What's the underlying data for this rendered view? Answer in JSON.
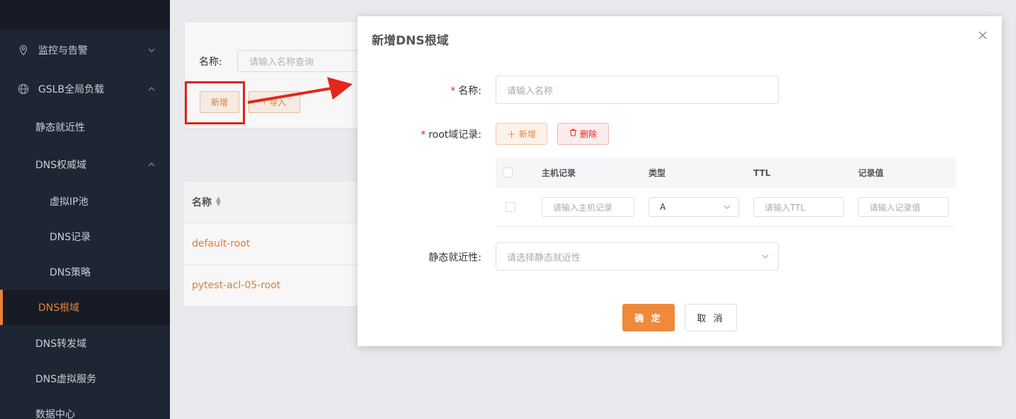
{
  "sidebar": {
    "items": [
      {
        "label": "监控与告警",
        "icon": "location-pin-icon"
      },
      {
        "label": "GSLB全局负载",
        "icon": "globe-icon"
      },
      {
        "label": "静态就近性"
      },
      {
        "label": "DNS权威域"
      },
      {
        "label": "虚拟IP池"
      },
      {
        "label": "DNS记录"
      },
      {
        "label": "DNS策略"
      },
      {
        "label": "DNS根域"
      },
      {
        "label": "DNS转发域"
      },
      {
        "label": "DNS虚拟服务"
      },
      {
        "label": "数据中心"
      }
    ],
    "active_color": "#e8823a"
  },
  "page": {
    "search_label": "名称:",
    "search_placeholder": "请输入名称查询",
    "add_button": "新增",
    "import_button": "导入",
    "table_header": "名称",
    "rows": [
      "default-root",
      "pytest-acl-05-root"
    ]
  },
  "dialog": {
    "title": "新增DNS根域",
    "name_label": "名称:",
    "name_placeholder": "请输入名称",
    "root_label": "root域记录:",
    "add_label": "新增",
    "delete_label": "删除",
    "columns": [
      "主机记录",
      "类型",
      "TTL",
      "记录值"
    ],
    "row": {
      "host_placeholder": "请输入主机记录",
      "type_value": "A",
      "ttl_placeholder": "请输入TTL",
      "value_placeholder": "请输入记录值"
    },
    "static_label": "静态就近性:",
    "static_placeholder": "请选择静态就近性",
    "confirm": "确 定",
    "cancel": "取 消"
  }
}
